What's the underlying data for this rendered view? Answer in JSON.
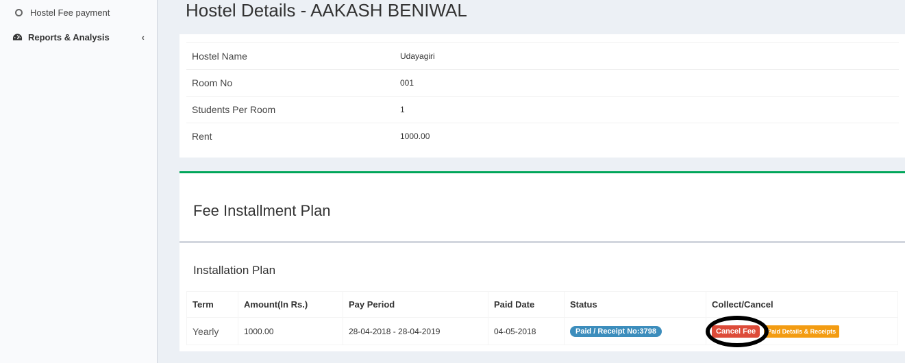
{
  "sidebar": {
    "items": [
      {
        "label": "Hostel Fee payment",
        "icon": "circle-icon"
      },
      {
        "label": "Reports & Analysis",
        "icon": "dashboard-icon"
      }
    ]
  },
  "page": {
    "title": "Hostel Details - AAKASH BENIWAL"
  },
  "hostel_details": {
    "rows": [
      {
        "label": "Hostel Name",
        "value": "Udayagiri"
      },
      {
        "label": "Room No",
        "value": "001"
      },
      {
        "label": "Students Per Room",
        "value": "1"
      },
      {
        "label": "Rent",
        "value": "1000.00"
      }
    ]
  },
  "fee_plan": {
    "title": "Fee Installment Plan",
    "subtitle": "Installation Plan",
    "headers": [
      "Term",
      "Amount(In Rs.)",
      "Pay Period",
      "Paid Date",
      "Status",
      "Collect/Cancel"
    ],
    "row": {
      "term": "Yearly",
      "amount": "1000.00",
      "pay_period": "28-04-2018 - 28-04-2019",
      "paid_date": "04-05-2018",
      "status": "Paid / Receipt No:3798",
      "cancel_label": "Cancel Fee",
      "receipts_label": "Paid Details & Receipts"
    }
  },
  "colors": {
    "accent_green": "#00a65a",
    "status_blue": "#3c8dbc",
    "cancel_red": "#dd4b39",
    "receipts_orange": "#f39c12"
  }
}
